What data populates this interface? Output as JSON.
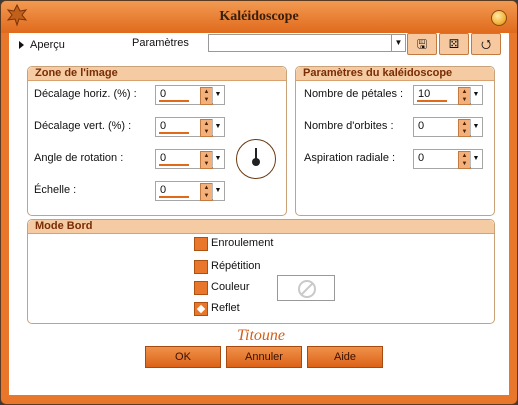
{
  "window": {
    "title": "Kaléidoscope",
    "signature": "Titoune"
  },
  "topbar": {
    "apercu_label": "Aperçu",
    "params_label": "Paramètres",
    "preset_value": "",
    "tools": [
      {
        "icon": "save-icon",
        "glyph": "🖫"
      },
      {
        "icon": "dice-icon",
        "glyph": "⚄"
      },
      {
        "icon": "reset-icon",
        "glyph": "⭯"
      }
    ]
  },
  "zone": {
    "title": "Zone de l'image",
    "fields": [
      {
        "label": "Décalage horiz. (%) :",
        "value": "0"
      },
      {
        "label": "Décalage vert. (%) :",
        "value": "0"
      },
      {
        "label": "Angle de rotation :",
        "value": "0"
      },
      {
        "label": "Échelle :",
        "value": "0"
      }
    ]
  },
  "kaleido": {
    "title": "Paramètres du kaléidoscope",
    "fields": [
      {
        "label": "Nombre de pétales :",
        "value": "10"
      },
      {
        "label": "Nombre d'orbites :",
        "value": "0"
      },
      {
        "label": "Aspiration radiale :",
        "value": "0"
      }
    ]
  },
  "mode": {
    "title": "Mode Bord",
    "options": [
      {
        "label": "Enroulement",
        "selected": false
      },
      {
        "label": "Répétition",
        "selected": false
      },
      {
        "label": "Couleur",
        "selected": false
      },
      {
        "label": "Reflet",
        "selected": true
      }
    ]
  },
  "buttons": {
    "ok": "OK",
    "cancel": "Annuler",
    "help": "Aide"
  },
  "colors": {
    "accent": "#e8772b",
    "title_text": "#7a2c05"
  }
}
